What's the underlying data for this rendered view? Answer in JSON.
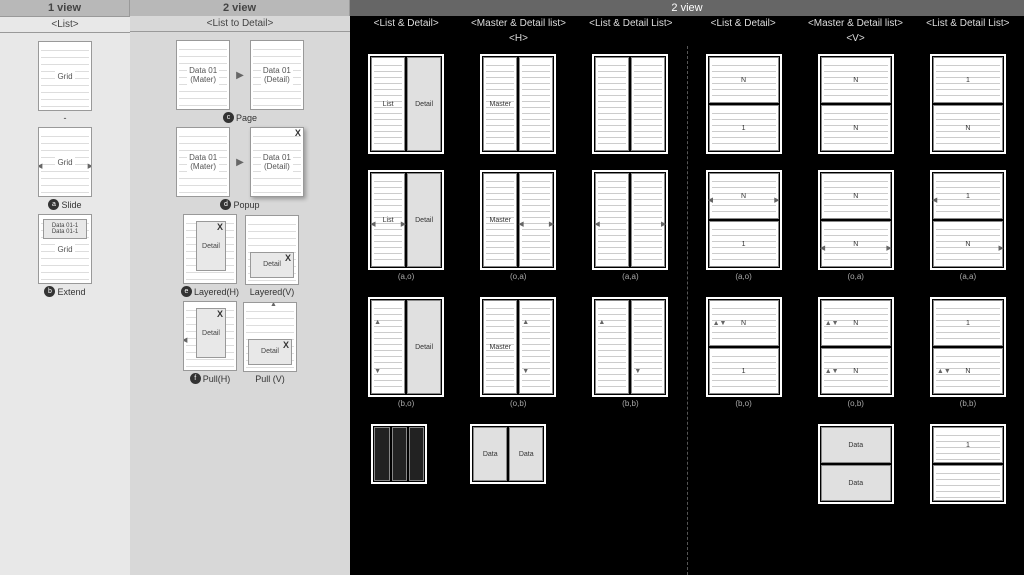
{
  "col1": {
    "header": "1 view",
    "sub": "<List>",
    "items": [
      {
        "t": "Grid",
        "cap": "-",
        "b": ""
      },
      {
        "t": "Grid",
        "cap": "Slide",
        "b": "a"
      },
      {
        "t": "Grid",
        "cap": "Extend",
        "b": "b"
      }
    ]
  },
  "col2": {
    "header": "2 view",
    "sub": "<List to Detail>",
    "items": [
      {
        "l": "Data 01\n(Mater)",
        "r": "Data 01\n(Detail)",
        "cap": "Page",
        "b": "c"
      },
      {
        "l": "Data 01\n(Mater)",
        "r": "Data 01\n(Detail)",
        "cap": "Popup",
        "b": "d",
        "rx": true
      },
      {
        "l": "Detail",
        "r": "Detail",
        "cap": "Layered(H)",
        "cap2": "Layered(V)",
        "b": "e",
        "lx": true,
        "rx": true
      },
      {
        "l": "Detail",
        "r": "Detail",
        "cap": "Pull(H)",
        "cap2": "Pull (V)",
        "b": "f",
        "lx": true,
        "rx": true
      }
    ]
  },
  "main": {
    "header": "2 view",
    "subs": [
      "<List & Detail>",
      "<Master & Detail list>",
      "<List & Detail List>",
      "<List & Detail>",
      "<Master & Detail list>",
      "<List & Detail List>"
    ],
    "hv": [
      "<H>",
      "<V>"
    ],
    "rowsH": [
      [
        [
          "List",
          "Detail"
        ],
        [
          "Master",
          ""
        ],
        [
          "",
          ""
        ]
      ],
      [
        [
          "List",
          "Detail"
        ],
        [
          "Master",
          ""
        ],
        [
          "",
          ""
        ]
      ],
      [
        [
          "",
          "Detail"
        ],
        [
          "Master",
          ""
        ],
        [
          "",
          ""
        ]
      ]
    ],
    "rowsV": [
      [
        [
          "N",
          "1"
        ],
        [
          "N",
          "N"
        ],
        [
          "1",
          "N"
        ]
      ],
      [
        [
          "N",
          "1"
        ],
        [
          "N",
          "N"
        ],
        [
          "1",
          "N"
        ]
      ],
      [
        [
          "N",
          "1"
        ],
        [
          "N",
          "N"
        ],
        [
          "1",
          "N"
        ]
      ]
    ],
    "caps": [
      "(a,o)",
      "(o,a)",
      "(a,a)",
      "(b,o)",
      "(o,b)",
      "(b,b)"
    ],
    "xtraH": [
      [
        "",
        "",
        ""
      ],
      [
        "Data",
        "Data"
      ]
    ],
    "xtraV": [
      [
        "Data",
        "Data"
      ],
      [
        "1",
        ""
      ]
    ]
  }
}
